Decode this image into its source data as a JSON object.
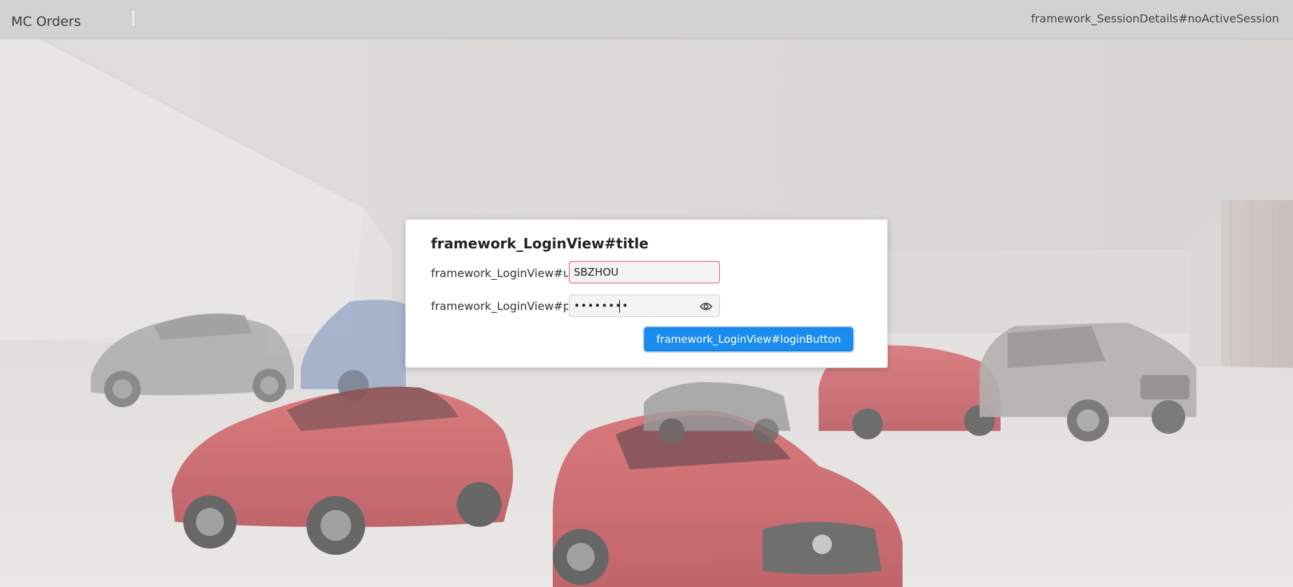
{
  "header": {
    "app_title": "MC Orders",
    "session_details": "framework_SessionDetails#noActiveSession"
  },
  "login": {
    "title": "framework_LoginView#title",
    "username_label": "framework_LoginView#username",
    "username_value": "SBZHOU",
    "password_label": "framework_LoginView#password",
    "password_value": "secret12",
    "show_password_icon": "eye-icon",
    "login_button_label": "framework_LoginView#loginButton"
  },
  "colors": {
    "header_bg": "#d2d2d2",
    "primary_button": "#1a8cf0",
    "invalid_border": "#e15a6e",
    "car_red": "#c4444a",
    "car_silver": "#9e9e9e",
    "car_blue": "#7e93b5"
  },
  "background": {
    "description_icon": "car-showroom-background"
  }
}
